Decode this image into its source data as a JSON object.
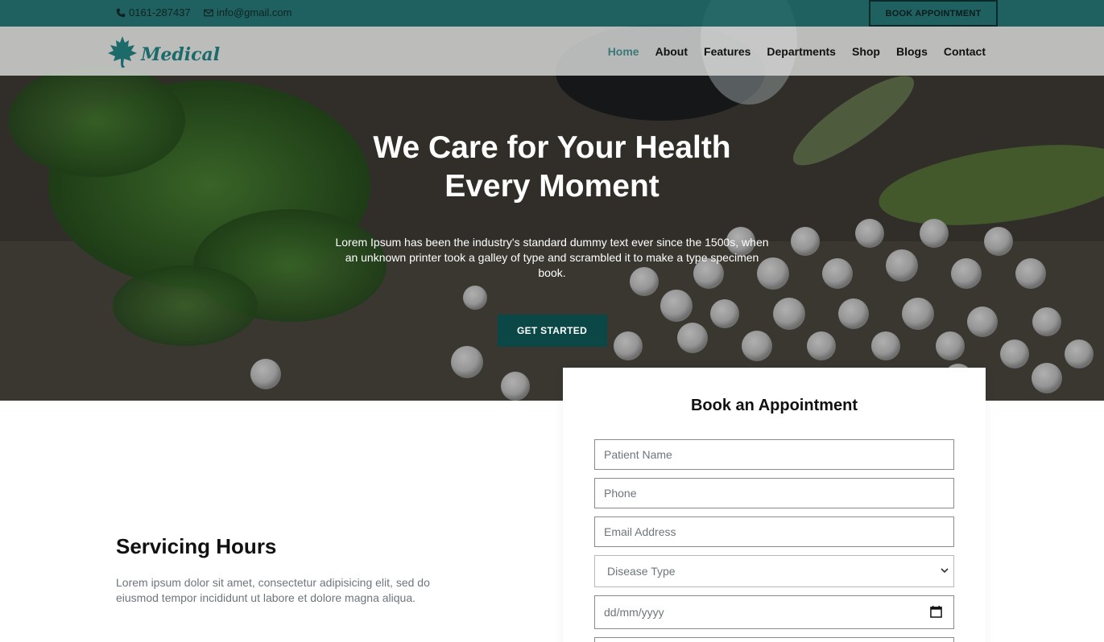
{
  "topbar": {
    "phone": "0161-287437",
    "email": "info@gmail.com",
    "book_button": "BOOK APPOINTMENT",
    "color": "#1c6868"
  },
  "nav": {
    "logo_text": "Medical",
    "links": [
      {
        "label": "Home",
        "active": true
      },
      {
        "label": "About"
      },
      {
        "label": "Features"
      },
      {
        "label": "Departments"
      },
      {
        "label": "Shop"
      },
      {
        "label": "Blogs"
      },
      {
        "label": "Contact"
      }
    ]
  },
  "hero": {
    "title": "We Care for Your Health Every Moment",
    "text": "Lorem Ipsum has been the industry's standard dummy text ever since the 1500s, when an unknown printer took a galley of type and scrambled it to make a type specimen book.",
    "cta": "GET STARTED",
    "cta_color": "#0b4747"
  },
  "servicing": {
    "title": "Servicing Hours",
    "text": "Lorem ipsum dolor sit amet, consectetur adipisicing elit, sed do eiusmod tempor incididunt ut labore et dolore magna aliqua."
  },
  "appointment": {
    "title": "Book an Appointment",
    "name_placeholder": "Patient Name",
    "phone_placeholder": "Phone",
    "email_placeholder": "Email Address",
    "disease_selected": "Disease Type",
    "date_placeholder": "dd/mm/yyyy"
  }
}
